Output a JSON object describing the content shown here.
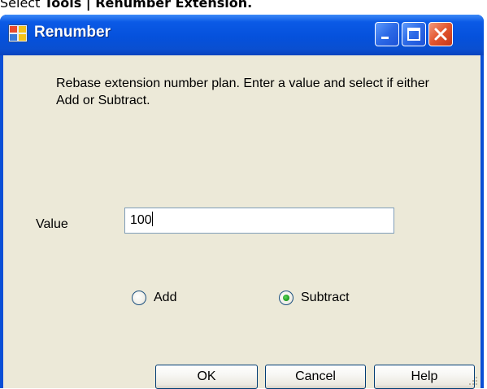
{
  "caption": {
    "prefix": "Select ",
    "menu_path": "Tools | Renumber Extension."
  },
  "window": {
    "title": "Renumber",
    "icon": "app-grid-icon",
    "controls": {
      "minimize_icon": "minimize-icon",
      "maximize_icon": "maximize-icon",
      "close_icon": "close-icon"
    }
  },
  "dialog": {
    "description": "Rebase extension number plan. Enter a value and select if either Add or Subtract.",
    "value_label": "Value",
    "value": "100",
    "options": [
      {
        "label": "Add",
        "selected": false
      },
      {
        "label": "Subtract",
        "selected": true
      }
    ],
    "buttons": {
      "ok": "OK",
      "cancel": "Cancel",
      "help": "Help"
    }
  },
  "colors": {
    "titlebar": "#0551dc",
    "dialog_bg": "#ece9d8",
    "close_button": "#e3552d",
    "radio_selected": "#21a121"
  }
}
